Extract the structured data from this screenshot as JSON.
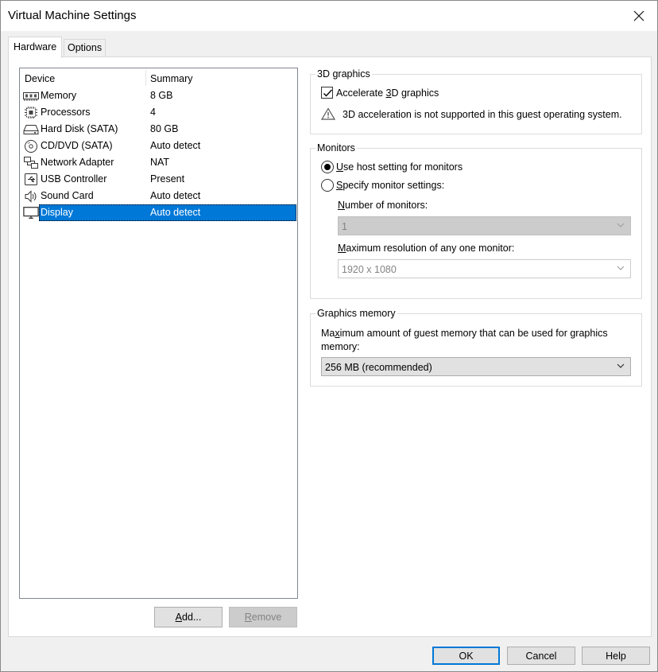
{
  "window": {
    "title": "Virtual Machine Settings"
  },
  "tabs": [
    {
      "label": "Hardware"
    },
    {
      "label": "Options"
    }
  ],
  "device_list": {
    "headers": {
      "device": "Device",
      "summary": "Summary"
    },
    "rows": [
      {
        "device": "Memory",
        "summary": "8 GB",
        "icon": "memory-icon"
      },
      {
        "device": "Processors",
        "summary": "4",
        "icon": "processor-icon"
      },
      {
        "device": "Hard Disk (SATA)",
        "summary": "80 GB",
        "icon": "hard-disk-icon"
      },
      {
        "device": "CD/DVD (SATA)",
        "summary": "Auto detect",
        "icon": "cd-dvd-icon"
      },
      {
        "device": "Network Adapter",
        "summary": "NAT",
        "icon": "network-icon"
      },
      {
        "device": "USB Controller",
        "summary": "Present",
        "icon": "usb-icon"
      },
      {
        "device": "Sound Card",
        "summary": "Auto detect",
        "icon": "speaker-icon"
      },
      {
        "device": "Display",
        "summary": "Auto detect",
        "icon": "monitor-icon",
        "selected": true
      }
    ],
    "add_button": {
      "pre": "",
      "u": "A",
      "post": "dd..."
    },
    "remove_button": {
      "pre": "",
      "u": "R",
      "post": "emove"
    }
  },
  "graphics3d": {
    "legend": "3D graphics",
    "accelerate": {
      "pre": "Accelerate ",
      "u": "3",
      "post": "D graphics",
      "checked": true
    },
    "warning": "3D acceleration is not supported in this guest operating system."
  },
  "monitors": {
    "legend": "Monitors",
    "host_setting": {
      "pre": "",
      "u": "U",
      "post": "se host setting for monitors",
      "selected": true
    },
    "specify": {
      "pre": "",
      "u": "S",
      "post": "pecify monitor settings:",
      "selected": false
    },
    "number_label": {
      "pre": "",
      "u": "N",
      "post": "umber of monitors:"
    },
    "number_value": "1",
    "maxres_label": {
      "pre": "",
      "u": "M",
      "post": "aximum resolution of any one monitor:"
    },
    "maxres_value": "1920 x 1080"
  },
  "graphics_memory": {
    "legend": "Graphics memory",
    "description_line1_pre": "Ma",
    "description_line1_u": "x",
    "description_line1_post": "imum amount of guest memory that can be used for graphics",
    "description_line2": "memory:",
    "value": "256 MB (recommended)"
  },
  "footer": {
    "ok": "OK",
    "cancel": "Cancel",
    "help": "Help"
  },
  "colors": {
    "selection": "#0078d7",
    "warning_icon": "#555555"
  }
}
